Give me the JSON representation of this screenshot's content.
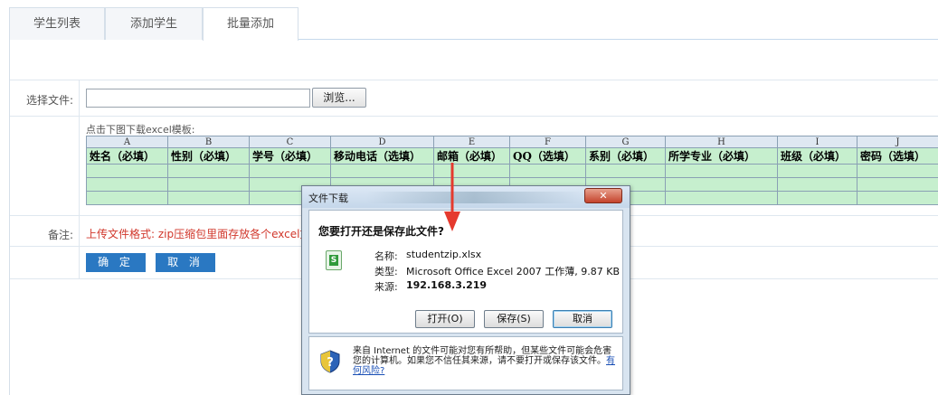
{
  "tabs": [
    {
      "label": "学生列表"
    },
    {
      "label": "添加学生"
    },
    {
      "label": "批量添加"
    }
  ],
  "form": {
    "file_label": "选择文件:",
    "file_value": "",
    "browse_label": "浏览...",
    "download_hint": "点击下图下载excel模板:",
    "remark_label": "备注:",
    "remark_text": "上传文件格式: zip压缩包里面存放各个excel文",
    "confirm_label": "确 定",
    "cancel_label": "取 消"
  },
  "excel_template": {
    "column_letters": [
      "A",
      "B",
      "C",
      "D",
      "E",
      "F",
      "G",
      "H",
      "I",
      "J"
    ],
    "headers": [
      "姓名（必填）",
      "性别（必填）",
      "学号（必填）",
      "移动电话（选填）",
      "邮箱（必填）",
      "QQ（选填）",
      "系别（必填）",
      "所学专业（必填）",
      "班级（必填）",
      "密码（选填）"
    ]
  },
  "dialog": {
    "title": "文件下载",
    "close_label": "✕",
    "question": "您要打开还是保存此文件?",
    "name_label": "名称:",
    "name_value": "studentzip.xlsx",
    "type_label": "类型:",
    "type_value": "Microsoft Office Excel 2007 工作薄, 9.87 KB",
    "source_label": "来源:",
    "source_value": "192.168.3.219",
    "open_label": "打开(O)",
    "save_label": "保存(S)",
    "cancel_label": "取消",
    "warning_text": "来自 Internet 的文件可能对您有所帮助，但某些文件可能会危害您的计算机。如果您不信任其来源，请不要打开或保存该文件。",
    "risk_link": "有何风险?"
  },
  "colors": {
    "accent": "#2a78c2",
    "remark_red": "#d1372b",
    "excel_green": "#c6efce",
    "arrow_red": "#e53a2e"
  }
}
